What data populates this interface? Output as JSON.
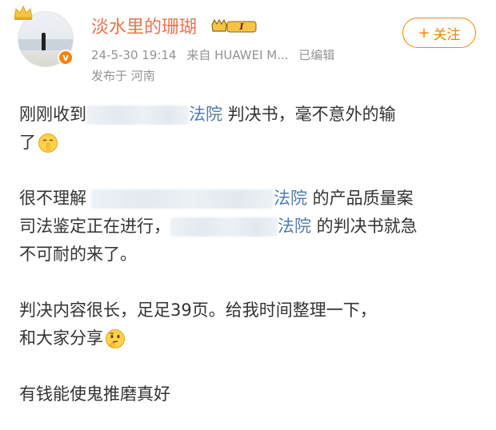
{
  "post": {
    "username": "淡水里的珊瑚",
    "level_badge_text": "I",
    "timestamp": "24-5-30 19:14",
    "source": "来自 HUAWEI M...",
    "edited": "已编辑",
    "location": "发布于 河南",
    "follow_label": "关注",
    "follow_icon": "+"
  },
  "content": {
    "p1": {
      "a": "刚刚收到",
      "court": "法院",
      "b": " 判决书，毫不意外的输",
      "c": "了"
    },
    "p2": {
      "a": "很不理解",
      "court1": "法院",
      "b": " 的产品质量案",
      "c": "司法鉴定正在进行，",
      "court2": "法院",
      "d": " 的判决书就急",
      "e": "不可耐的来了。"
    },
    "p3": {
      "a": "判决内容很长，足足39页。给我时间整理一下，",
      "b": "和大家分享"
    },
    "p4": {
      "a": "有钱能使鬼推磨真好"
    }
  },
  "icons": {
    "crown": "crown-icon",
    "verified": "verified-v-icon",
    "level": "level-badge-icon",
    "emoji_shh": "shush-emoji-icon",
    "emoji_think": "thinking-emoji-icon"
  },
  "colors": {
    "username": "#eb7350",
    "accent": "#ff8200",
    "link": "#507daf",
    "meta": "#939393",
    "text": "#333333"
  }
}
